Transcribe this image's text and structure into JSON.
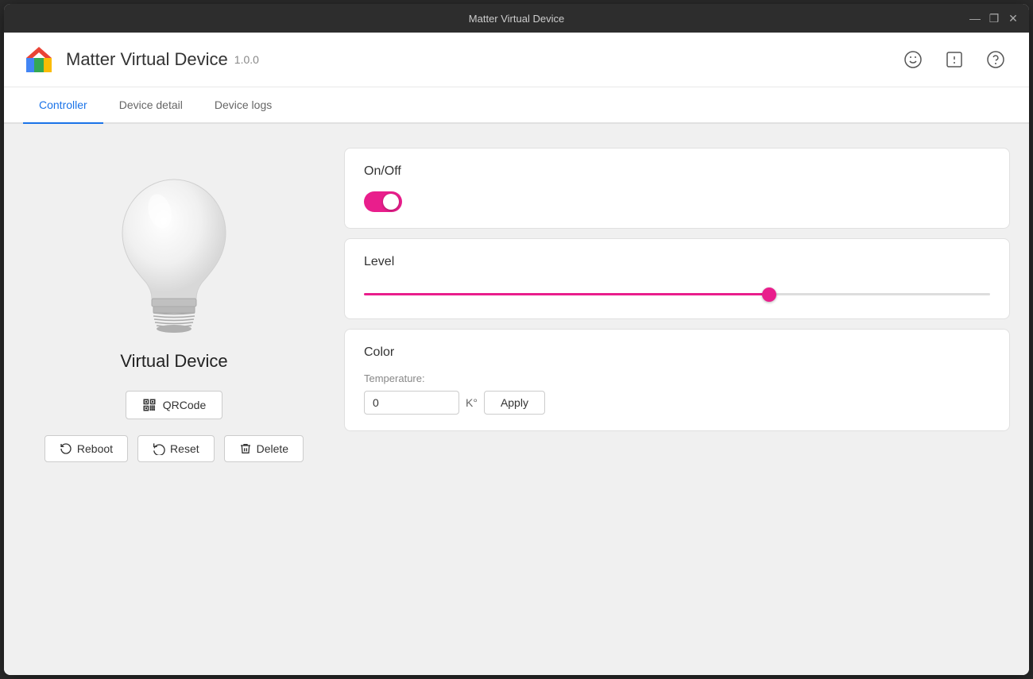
{
  "titlebar": {
    "title": "Matter Virtual Device",
    "minimize": "—",
    "maximize": "❐",
    "close": "✕"
  },
  "header": {
    "app_title": "Matter Virtual Device",
    "app_version": "1.0.0",
    "icons": {
      "smiley": "☺",
      "feedback": "⊡",
      "help": "?"
    }
  },
  "tabs": [
    {
      "id": "controller",
      "label": "Controller",
      "active": true
    },
    {
      "id": "device-detail",
      "label": "Device detail",
      "active": false
    },
    {
      "id": "device-logs",
      "label": "Device logs",
      "active": false
    }
  ],
  "left_panel": {
    "device_name": "Virtual Device",
    "qrcode_btn": "QRCode",
    "reboot_btn": "Reboot",
    "reset_btn": "Reset",
    "delete_btn": "Delete"
  },
  "cards": {
    "on_off": {
      "title": "On/Off",
      "state": true
    },
    "level": {
      "title": "Level",
      "value": 65
    },
    "color": {
      "title": "Color",
      "temperature_label": "Temperature:",
      "temperature_value": "0",
      "unit": "K°",
      "apply_label": "Apply"
    }
  }
}
